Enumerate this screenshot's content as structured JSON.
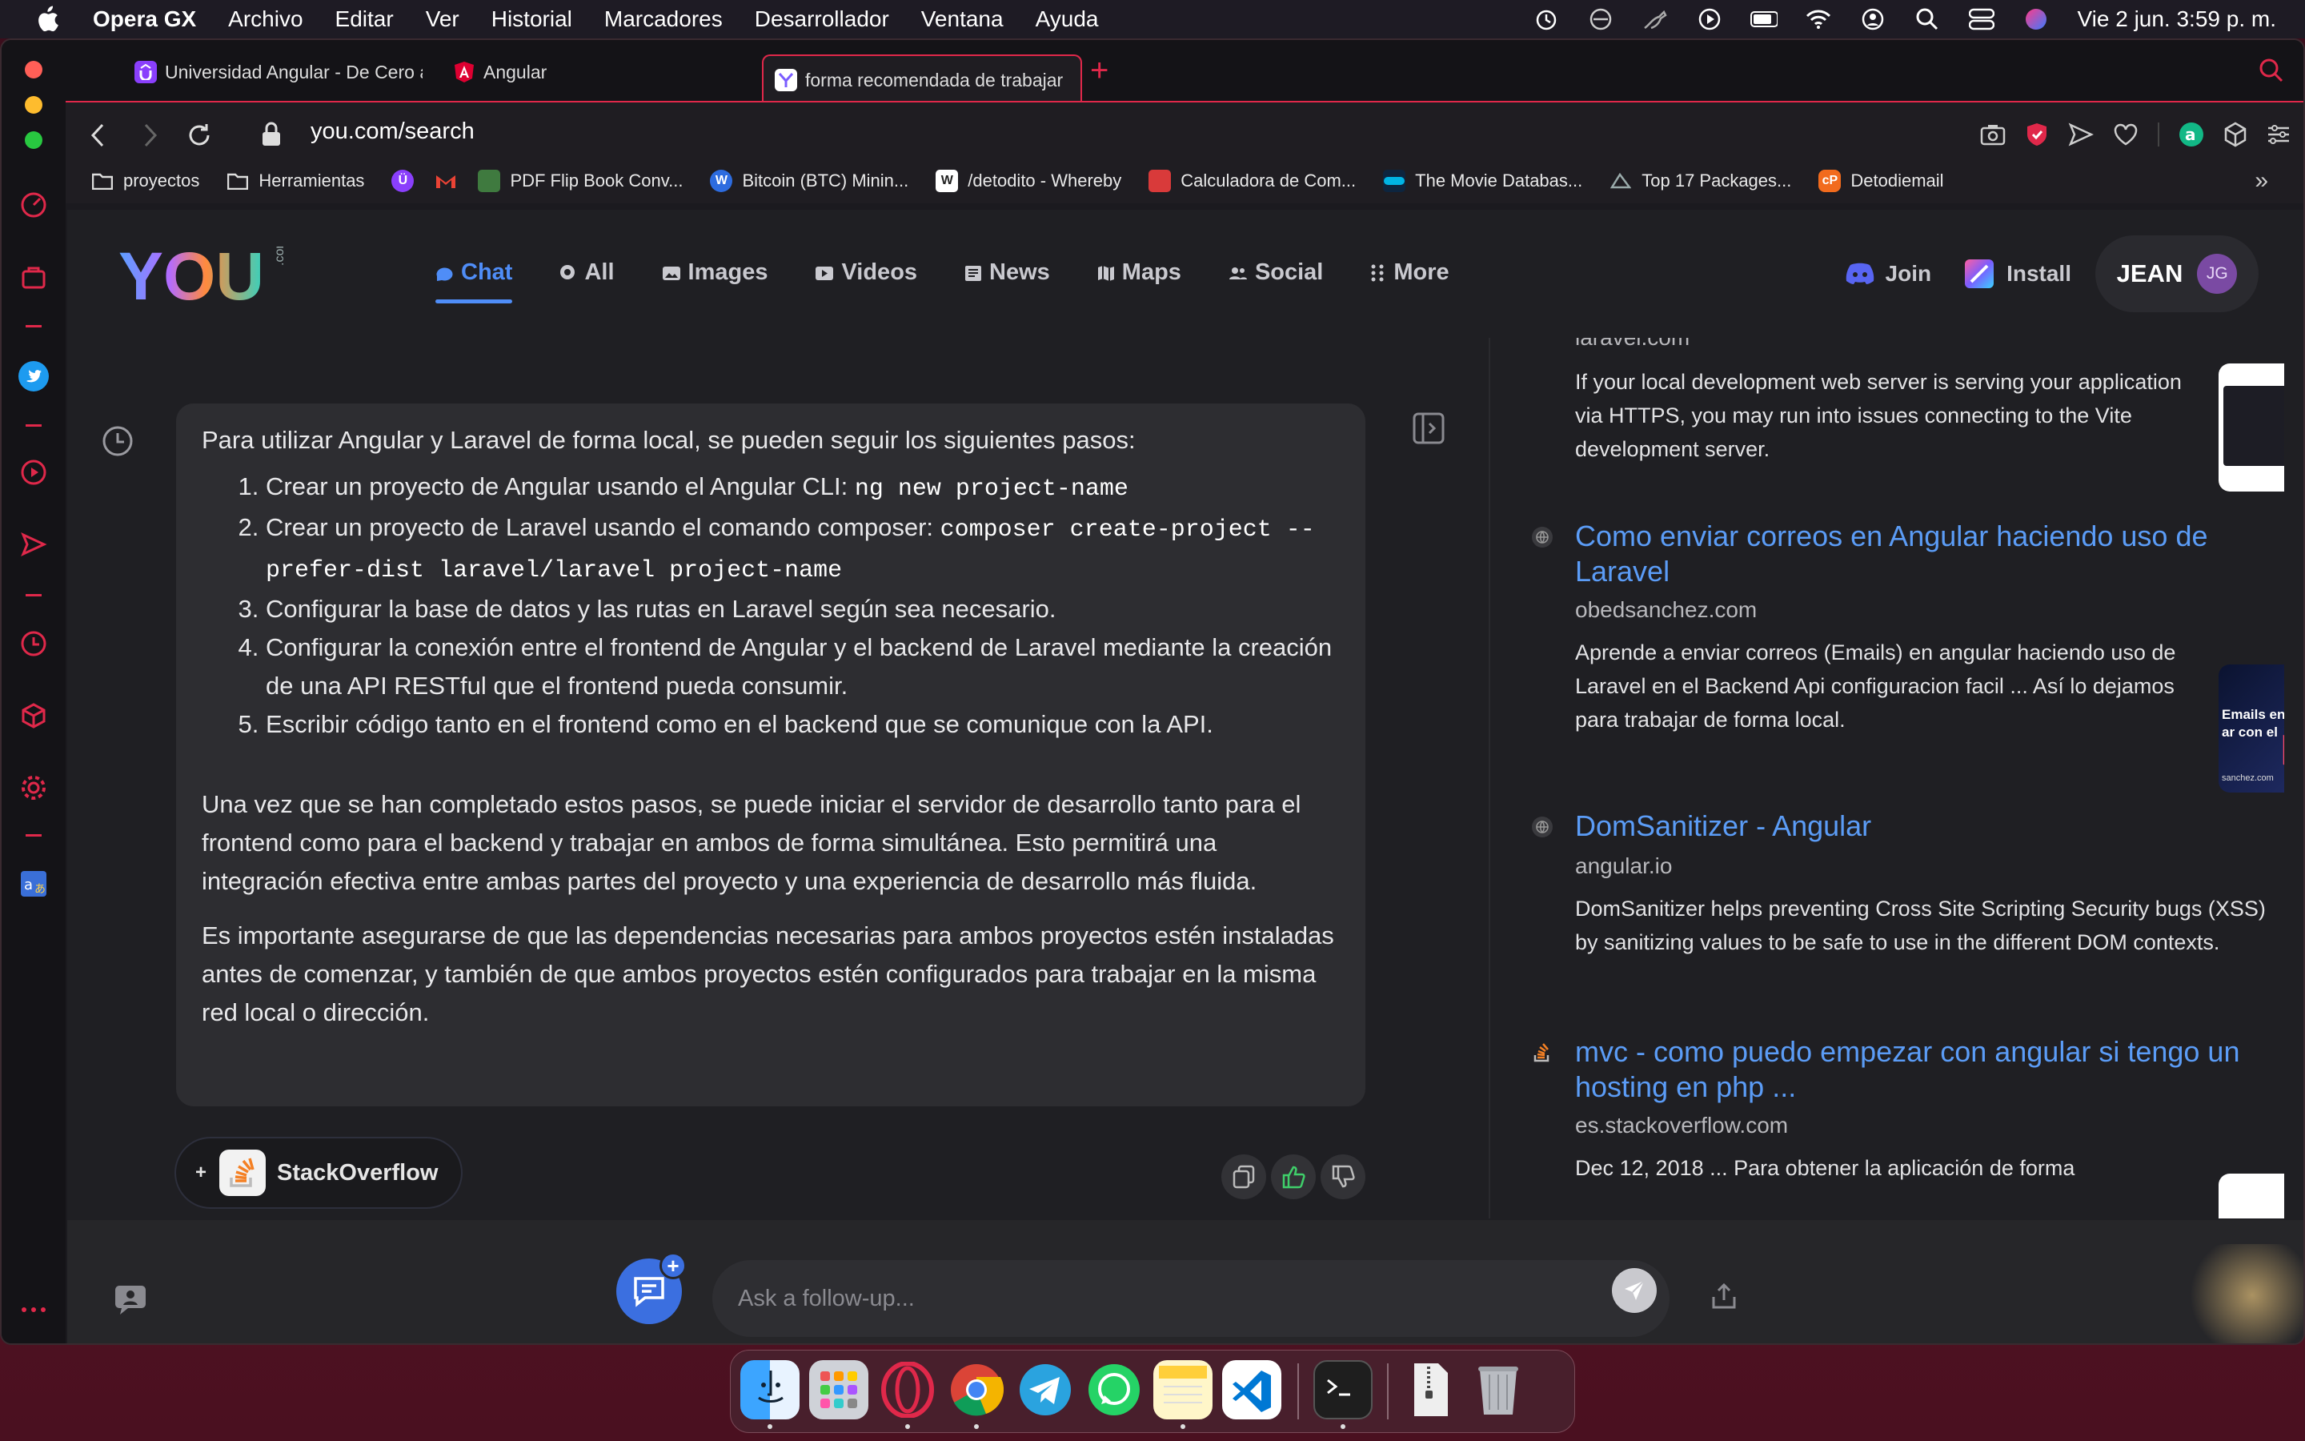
{
  "menubar": {
    "app": "Opera GX",
    "items": [
      "Archivo",
      "Editar",
      "Ver",
      "Historial",
      "Marcadores",
      "Desarrollador",
      "Ventana",
      "Ayuda"
    ],
    "datetime": "Vie 2 jun.  3:59 p. m."
  },
  "tabs": [
    {
      "title": "Universidad Angular - De Cero a"
    },
    {
      "title": "Angular"
    },
    {
      "title": "forma recomendada de trabajar"
    }
  ],
  "address": {
    "url": "you.com/search"
  },
  "bookmarks": [
    "proyectos",
    "Herramientas",
    "PDF Flip Book Conv...",
    "Bitcoin (BTC) Minin...",
    "/detodito - Whereby",
    "Calculadora de Com...",
    "The Movie Databas...",
    "Top 17 Packages...",
    "Detodiemail"
  ],
  "header": {
    "logo": "YOU",
    "logo_suffix": ".com",
    "nav": [
      {
        "label": "Chat",
        "icon": "chat-icon",
        "active": true
      },
      {
        "label": "All",
        "icon": "search-icon"
      },
      {
        "label": "Images",
        "icon": "images-icon"
      },
      {
        "label": "Videos",
        "icon": "videos-icon"
      },
      {
        "label": "News",
        "icon": "news-icon"
      },
      {
        "label": "Maps",
        "icon": "maps-icon"
      },
      {
        "label": "Social",
        "icon": "social-icon"
      },
      {
        "label": "More",
        "icon": "grid-icon"
      }
    ],
    "join": "Join",
    "install": "Install",
    "user": "JEAN",
    "avatar": "JG"
  },
  "answer": {
    "intro": "Para utilizar Angular y Laravel de forma local, se pueden seguir los siguientes pasos:",
    "steps": [
      {
        "text": "Crear un proyecto de Angular usando el Angular CLI: ",
        "code": "ng new project-name"
      },
      {
        "text": "Crear un proyecto de Laravel usando el comando composer: ",
        "code": "composer create-project --prefer-dist laravel/laravel project-name"
      },
      {
        "text": "Configurar la base de datos y las rutas en Laravel según sea necesario.",
        "code": ""
      },
      {
        "text": "Configurar la conexión entre el frontend de Angular y el backend de Laravel mediante la creación de una API RESTful que el frontend pueda consumir.",
        "code": ""
      },
      {
        "text": "Escribir código tanto en el frontend como en el backend que se comunique con la API.",
        "code": ""
      }
    ],
    "para1": "Una vez que se han completado estos pasos, se puede iniciar el servidor de desarrollo tanto para el frontend como para el backend y trabajar en ambos de forma simultánea. Esto permitirá una integración efectiva entre ambas partes del proyecto y una experiencia de desarrollo más fluida.",
    "para2": "Es importante asegurarse de que las dependencias necesarias para ambos proyectos estén instaladas antes de comenzar, y también de que ambos proyectos estén configurados para trabajar en la misma red local o dirección."
  },
  "source_pill": {
    "plus": "+",
    "label": "StackOverflow"
  },
  "results": [
    {
      "domain": "laravel.com",
      "snippet": "If your local development web server is serving your application via HTTPS, you may run into issues connecting to the Vite development server."
    },
    {
      "title": "Como enviar correos en Angular haciendo uso de Laravel",
      "domain": "obedsanchez.com",
      "snippet": "Aprende a enviar correos (Emails) en angular haciendo uso de Laravel en el Backend Api configuracion facil ... Así lo dejamos para trabajar de forma local.",
      "thumb_text": "Emails en ar con el",
      "thumb_sub": "sanchez.com"
    },
    {
      "title": "DomSanitizer - Angular",
      "domain": "angular.io",
      "snippet": "DomSanitizer helps preventing Cross Site Scripting Security bugs (XSS) by sanitizing values to be safe to use in the different DOM contexts."
    },
    {
      "title": "mvc - como puedo empezar con angular si tengo un hosting en php ...",
      "domain": "es.stackoverflow.com",
      "snippet": "Dec 12, 2018 ... Para obtener la aplicación de forma"
    }
  ],
  "followup": {
    "placeholder": "Ask a follow-up..."
  },
  "colors": {
    "accent": "#4f8df7",
    "opera_red": "#e0284a",
    "panel": "#2d2d31"
  }
}
